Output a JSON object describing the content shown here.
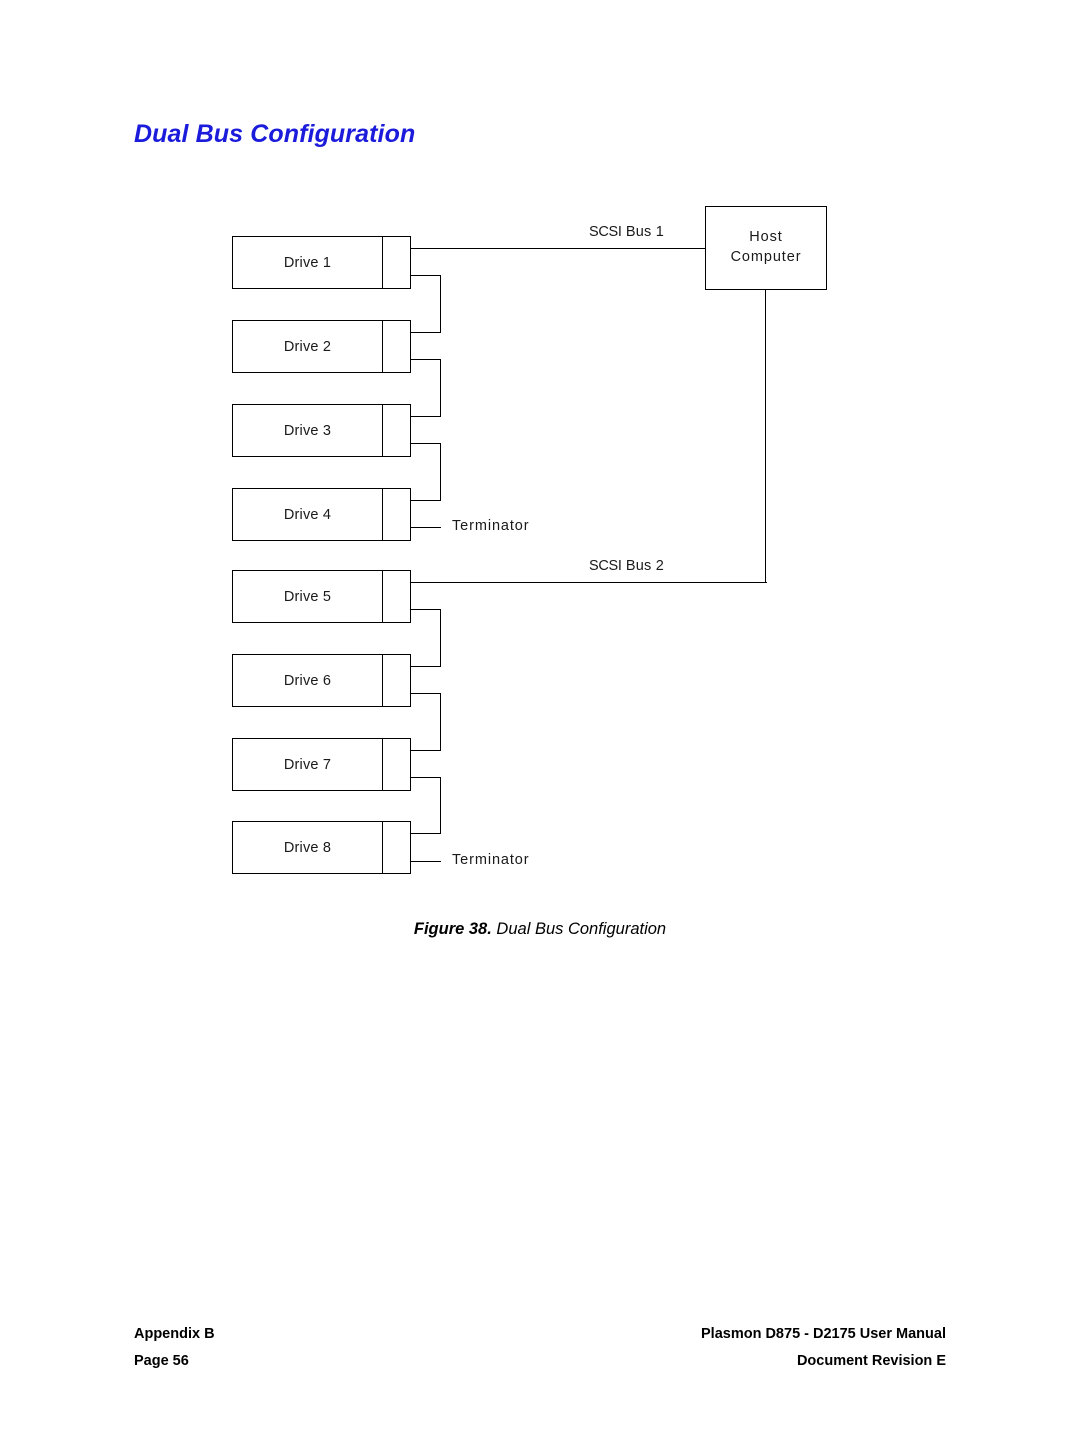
{
  "document": {
    "title": "Dual Bus Configuration"
  },
  "figure": {
    "caption_number": "Figure 38.",
    "caption_text": "Dual Bus Configuration",
    "host": {
      "line1": "Host",
      "line2": "Computer"
    },
    "buses": [
      {
        "id": "scsi-bus-1",
        "label_prefix": "SCSI",
        "label_suffix": " Bus 1",
        "label": "SCSI Bus 1"
      },
      {
        "id": "scsi-bus-2",
        "label_prefix": "SCSI",
        "label_suffix": " Bus 2",
        "label": "SCSI Bus 2"
      }
    ],
    "drives": [
      {
        "label": "Drive 1",
        "bus": "SCSI Bus 1"
      },
      {
        "label": "Drive 2",
        "bus": "SCSI Bus 1"
      },
      {
        "label": "Drive 3",
        "bus": "SCSI Bus 1"
      },
      {
        "label": "Drive 4",
        "bus": "SCSI Bus 1"
      },
      {
        "label": "Drive 5",
        "bus": "SCSI Bus 2"
      },
      {
        "label": "Drive 6",
        "bus": "SCSI Bus 2"
      },
      {
        "label": "Drive 7",
        "bus": "SCSI Bus 2"
      },
      {
        "label": "Drive 8",
        "bus": "SCSI Bus 2"
      }
    ],
    "terminators": [
      {
        "label": "Terminator",
        "attached_to": "Drive 4"
      },
      {
        "label": "Terminator",
        "attached_to": "Drive 8"
      }
    ]
  },
  "footer": {
    "left_top": "Appendix B",
    "left_bottom": "Page 56",
    "right_top": "Plasmon D875 - D2175 User Manual",
    "right_bottom": "Document Revision E"
  },
  "colors": {
    "heading": "#1b1bdb",
    "line": "#000000",
    "text": "#1a1a1a"
  }
}
